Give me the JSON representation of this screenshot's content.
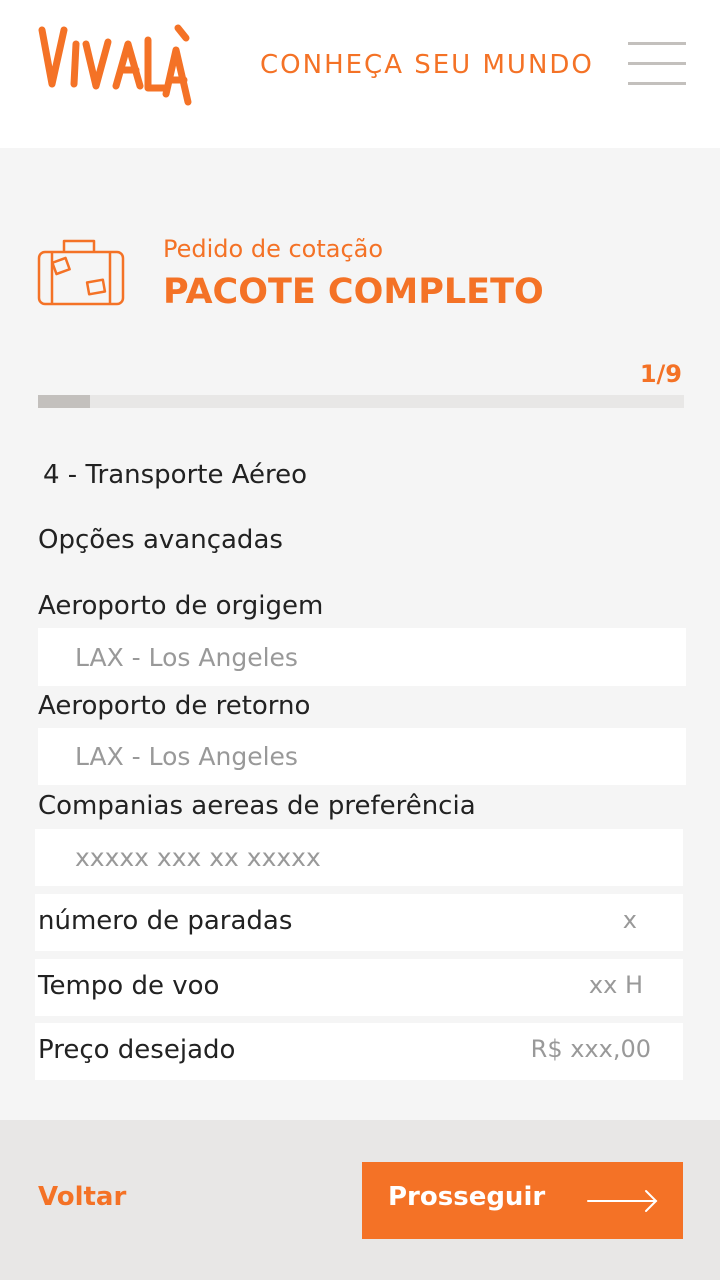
{
  "header": {
    "logo_text": "VIVALÁ",
    "tagline": "CONHEÇA SEU MUNDO",
    "menu_icon": "hamburger-icon"
  },
  "page": {
    "subtitle": "Pedido de cotação",
    "title": "PACOTE COMPLETO",
    "icon": "suitcase-icon"
  },
  "progress": {
    "step_text": "1/9",
    "fraction": 0.08
  },
  "form": {
    "section_title": "4 - Transporte Aéreo",
    "advanced_label": "Opções avançadas",
    "origin": {
      "label": "Aeroporto de orgigem",
      "placeholder": "LAX - Los Angeles"
    },
    "return": {
      "label": "Aeroporto de retorno",
      "placeholder": "LAX - Los Angeles"
    },
    "airlines": {
      "label": "Companias aereas de preferência",
      "placeholder": "xxxxx xxx xx xxxxx"
    },
    "stops": {
      "label": "número de paradas",
      "value": "x"
    },
    "flight_time": {
      "label": "Tempo de voo",
      "value": "xx H"
    },
    "price": {
      "label": "Preço desejado",
      "value": "R$ xxx,00"
    }
  },
  "footer": {
    "back_label": "Voltar",
    "next_label": "Prosseguir",
    "next_icon": "arrow-right-icon"
  },
  "colors": {
    "accent": "#f47226",
    "background": "#f5f5f5",
    "footer_bg": "#e8e7e6",
    "progress_fill": "#c3c0bd"
  }
}
